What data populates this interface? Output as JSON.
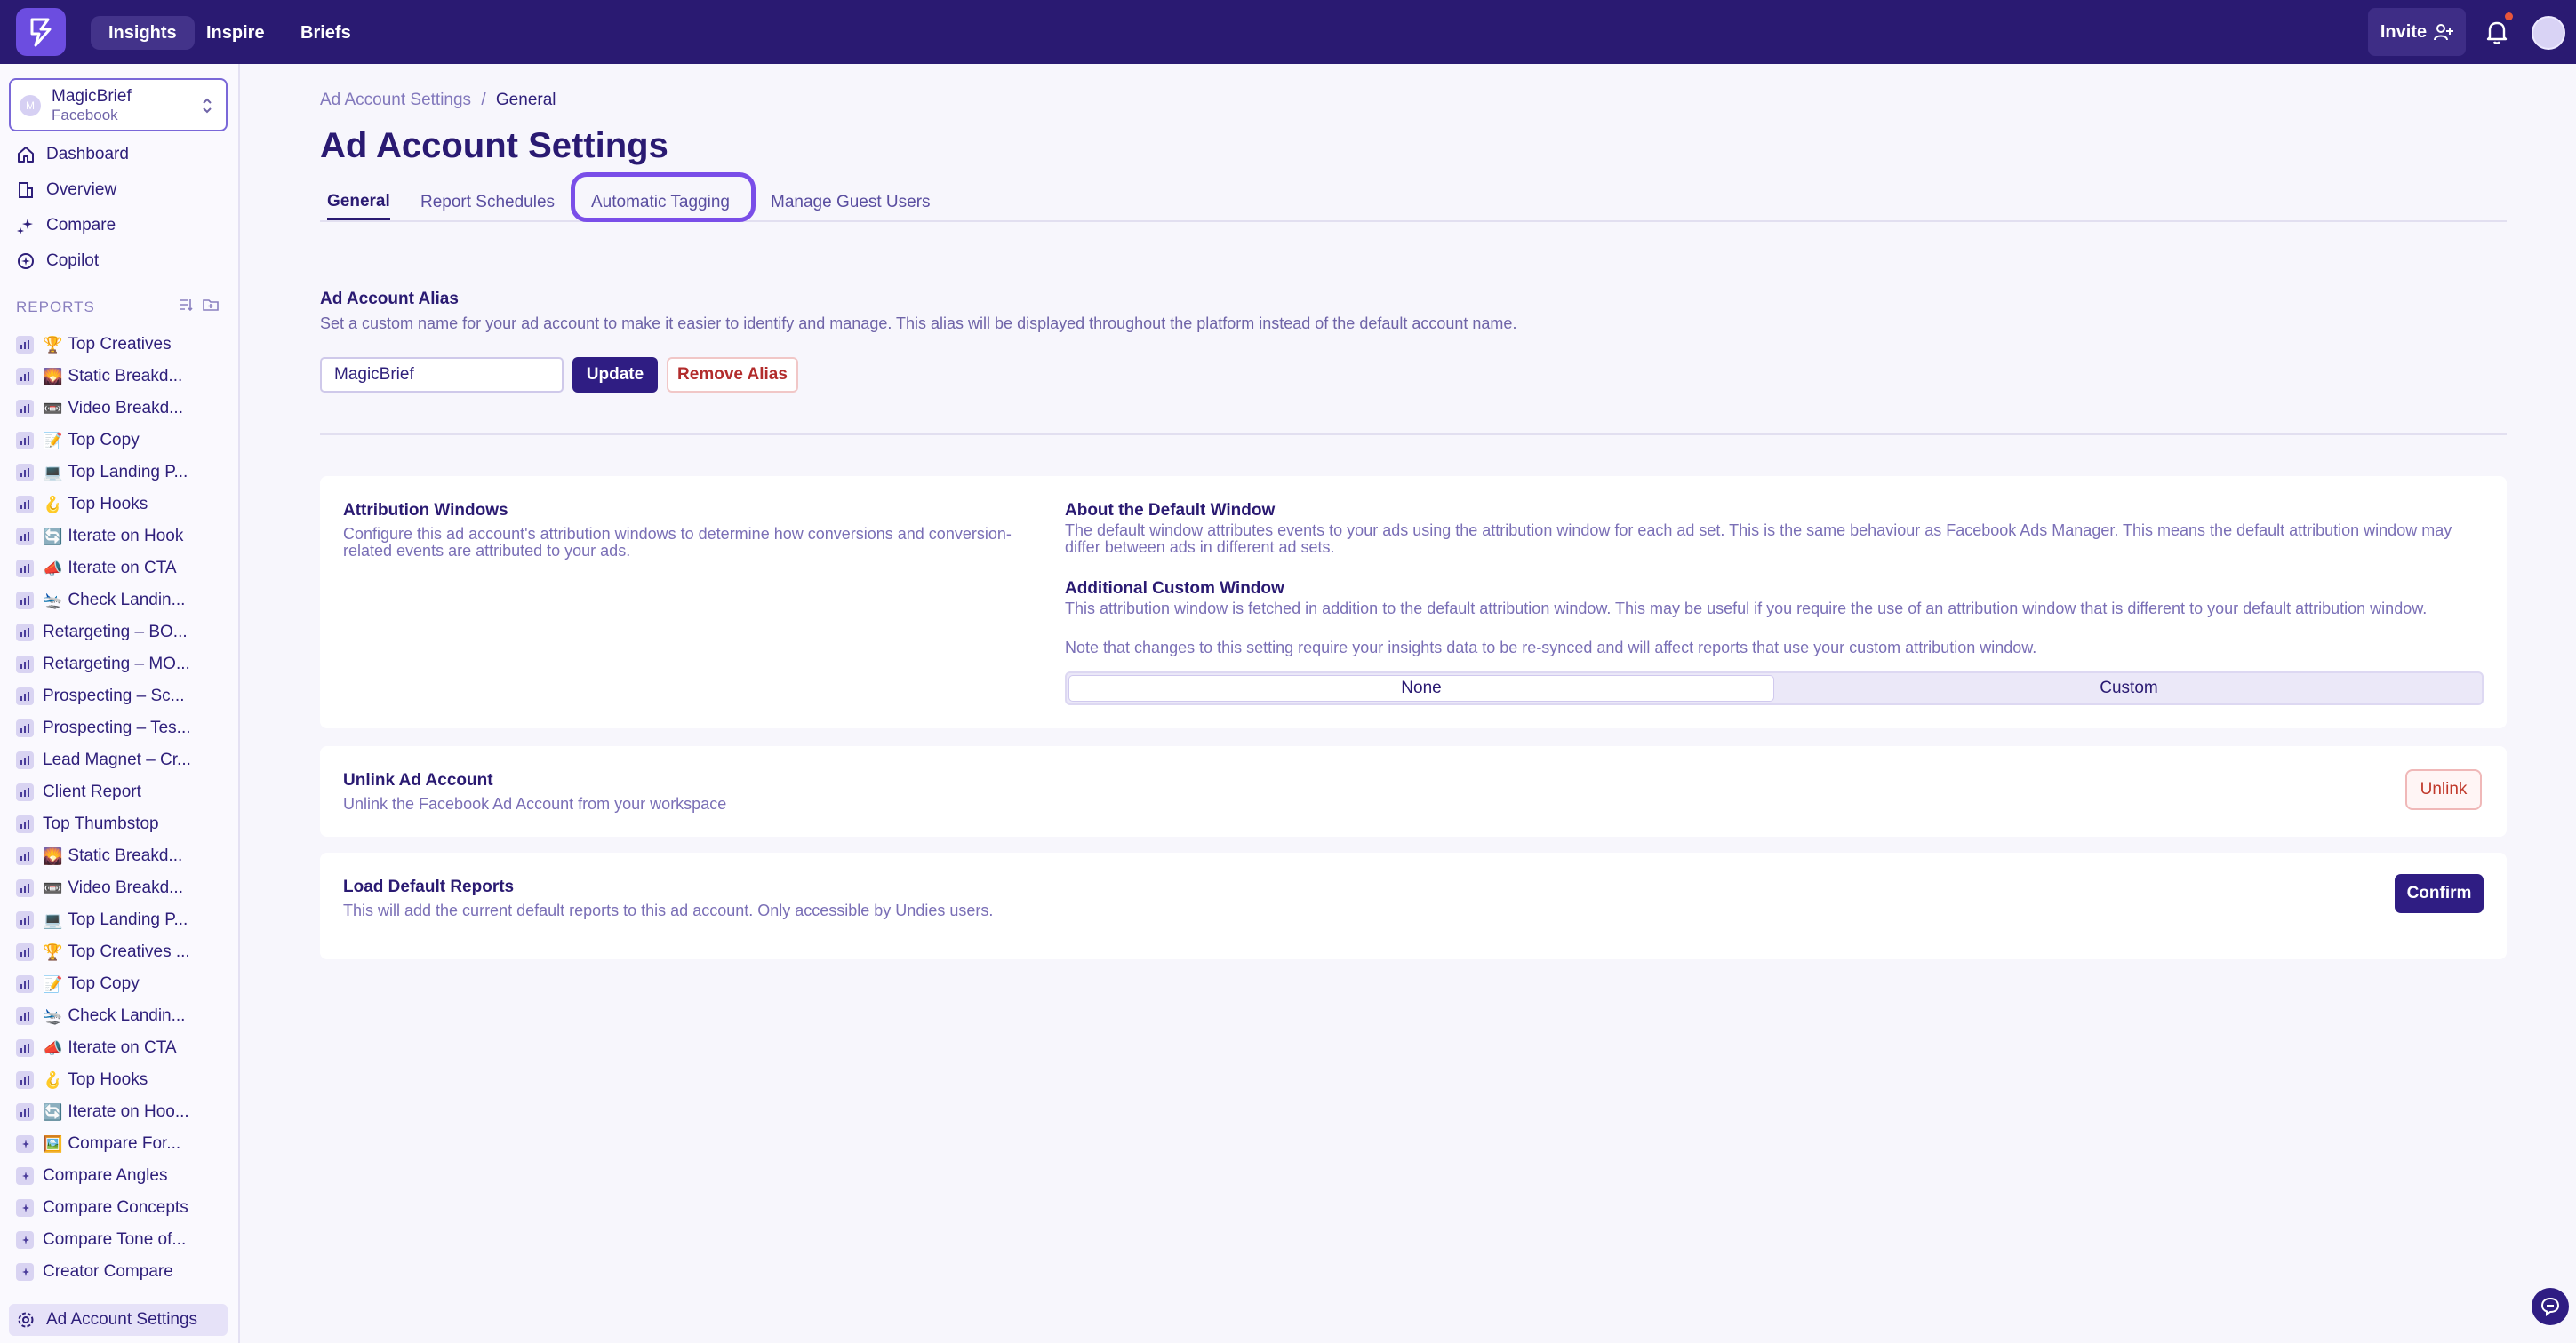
{
  "topnav": {
    "tabs": [
      "Insights",
      "Inspire",
      "Briefs"
    ],
    "invite_label": "Invite"
  },
  "sidebar": {
    "account": {
      "avatar_letter": "M",
      "name": "MagicBrief",
      "platform": "Facebook"
    },
    "nav": [
      {
        "label": "Dashboard",
        "icon": "home-icon"
      },
      {
        "label": "Overview",
        "icon": "building-icon"
      },
      {
        "label": "Compare",
        "icon": "sparkle-icon"
      },
      {
        "label": "Copilot",
        "icon": "copilot-icon"
      }
    ],
    "reports_heading": "REPORTS",
    "reports": [
      {
        "emoji": "🏆",
        "label": "Top Creatives"
      },
      {
        "emoji": "🌄",
        "label": "Static Breakd..."
      },
      {
        "emoji": "📼",
        "label": "Video Breakd..."
      },
      {
        "emoji": "📝",
        "label": "Top Copy"
      },
      {
        "emoji": "💻",
        "label": "Top Landing P..."
      },
      {
        "emoji": "🪝",
        "label": "Top Hooks"
      },
      {
        "emoji": "🔄",
        "label": "Iterate on Hook"
      },
      {
        "emoji": "📣",
        "label": "Iterate on CTA"
      },
      {
        "emoji": "🛬",
        "label": "Check Landin..."
      },
      {
        "emoji": "",
        "label": "Retargeting – BO..."
      },
      {
        "emoji": "",
        "label": "Retargeting – MO..."
      },
      {
        "emoji": "",
        "label": "Prospecting – Sc..."
      },
      {
        "emoji": "",
        "label": "Prospecting – Tes..."
      },
      {
        "emoji": "",
        "label": "Lead Magnet – Cr..."
      },
      {
        "emoji": "",
        "label": "Client Report"
      },
      {
        "emoji": "",
        "label": "Top Thumbstop"
      },
      {
        "emoji": "🌄",
        "label": "Static Breakd..."
      },
      {
        "emoji": "📼",
        "label": "Video Breakd..."
      },
      {
        "emoji": "💻",
        "label": "Top Landing P..."
      },
      {
        "emoji": "🏆",
        "label": "Top Creatives ..."
      },
      {
        "emoji": "📝",
        "label": "Top Copy"
      },
      {
        "emoji": "🛬",
        "label": "Check Landin..."
      },
      {
        "emoji": "📣",
        "label": "Iterate on CTA"
      },
      {
        "emoji": "🪝",
        "label": "Top Hooks"
      },
      {
        "emoji": "🔄",
        "label": "Iterate on Hoo..."
      },
      {
        "emoji": "🖼️",
        "label": "Compare For...",
        "compare": true
      },
      {
        "emoji": "",
        "label": "Compare Angles",
        "compare": true
      },
      {
        "emoji": "",
        "label": "Compare Concepts",
        "compare": true
      },
      {
        "emoji": "",
        "label": "Compare Tone of...",
        "compare": true
      },
      {
        "emoji": "",
        "label": "Creator Compare",
        "compare": true
      }
    ],
    "bottom_item": "Ad Account Settings"
  },
  "main": {
    "breadcrumb": {
      "parent": "Ad Account Settings",
      "separator": "/",
      "current": "General"
    },
    "title": "Ad Account Settings",
    "tabs": [
      "General",
      "Report Schedules",
      "Automatic Tagging",
      "Manage Guest Users"
    ],
    "alias": {
      "title": "Ad Account Alias",
      "description": "Set a custom name for your ad account to make it easier to identify and manage. This alias will be displayed throughout the platform instead of the default account name.",
      "value": "MagicBrief",
      "update_label": "Update",
      "remove_label": "Remove Alias"
    },
    "attribution": {
      "title": "Attribution Windows",
      "description": "Configure this ad account's attribution windows to determine how conversions and conversion-related events are attributed to your ads.",
      "default_title": "About the Default Window",
      "default_text": "The default window attributes events to your ads using the attribution window for each ad set. This is the same behaviour as Facebook Ads Manager. This means the default attribution window may differ between ads in different ad sets.",
      "custom_title": "Additional Custom Window",
      "custom_text": "This attribution window is fetched in addition to the default attribution window. This may be useful if you require the use of an attribution window that is different to your default attribution window.",
      "note": "Note that changes to this setting require your insights data to be re-synced and will affect reports that use your custom attribution window.",
      "options": [
        "None",
        "Custom"
      ]
    },
    "unlink": {
      "title": "Unlink Ad Account",
      "description": "Unlink the Facebook Ad Account from your workspace",
      "button": "Unlink"
    },
    "load_reports": {
      "title": "Load Default Reports",
      "description": "This will add the current default reports to this ad account. Only accessible by Undies users.",
      "button": "Confirm"
    }
  },
  "colors": {
    "topbar": "#2a1a72",
    "accent": "#2f1d83",
    "focus_ring": "#7a4ee8",
    "danger": "#c0392b"
  }
}
